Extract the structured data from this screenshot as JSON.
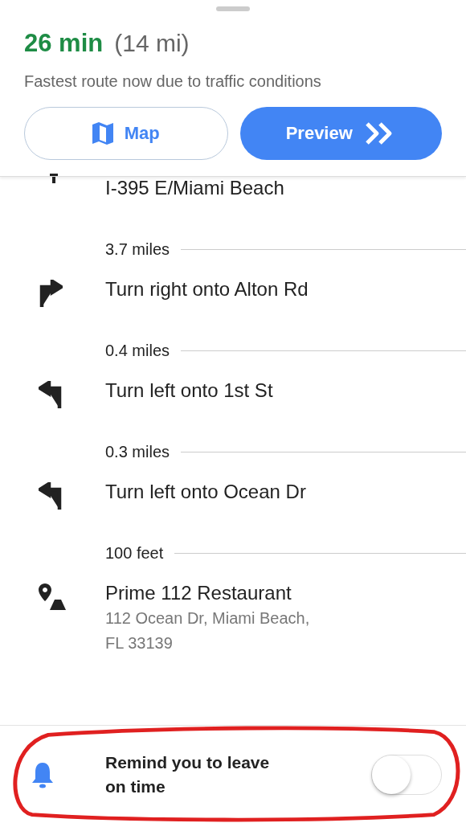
{
  "summary": {
    "duration": "26 min",
    "distance": "(14 mi)",
    "note": "Fastest route now due to traffic conditions"
  },
  "buttons": {
    "map": "Map",
    "preview": "Preview"
  },
  "steps": [
    {
      "kind": "straight",
      "instruction": "I-395 E/Miami Beach",
      "distance": "3.7 miles"
    },
    {
      "kind": "right",
      "instruction": "Turn right onto Alton Rd",
      "distance": "0.4 miles"
    },
    {
      "kind": "left",
      "instruction": "Turn left onto 1st St",
      "distance": "0.3 miles"
    },
    {
      "kind": "left",
      "instruction": "Turn left onto Ocean Dr",
      "distance": "100 feet"
    },
    {
      "kind": "destination",
      "instruction": "Prime 112 Restaurant",
      "address": "112 Ocean Dr, Miami Beach,\nFL 33139"
    }
  ],
  "reminder": {
    "label": "Remind you to leave\non time",
    "on": false
  }
}
